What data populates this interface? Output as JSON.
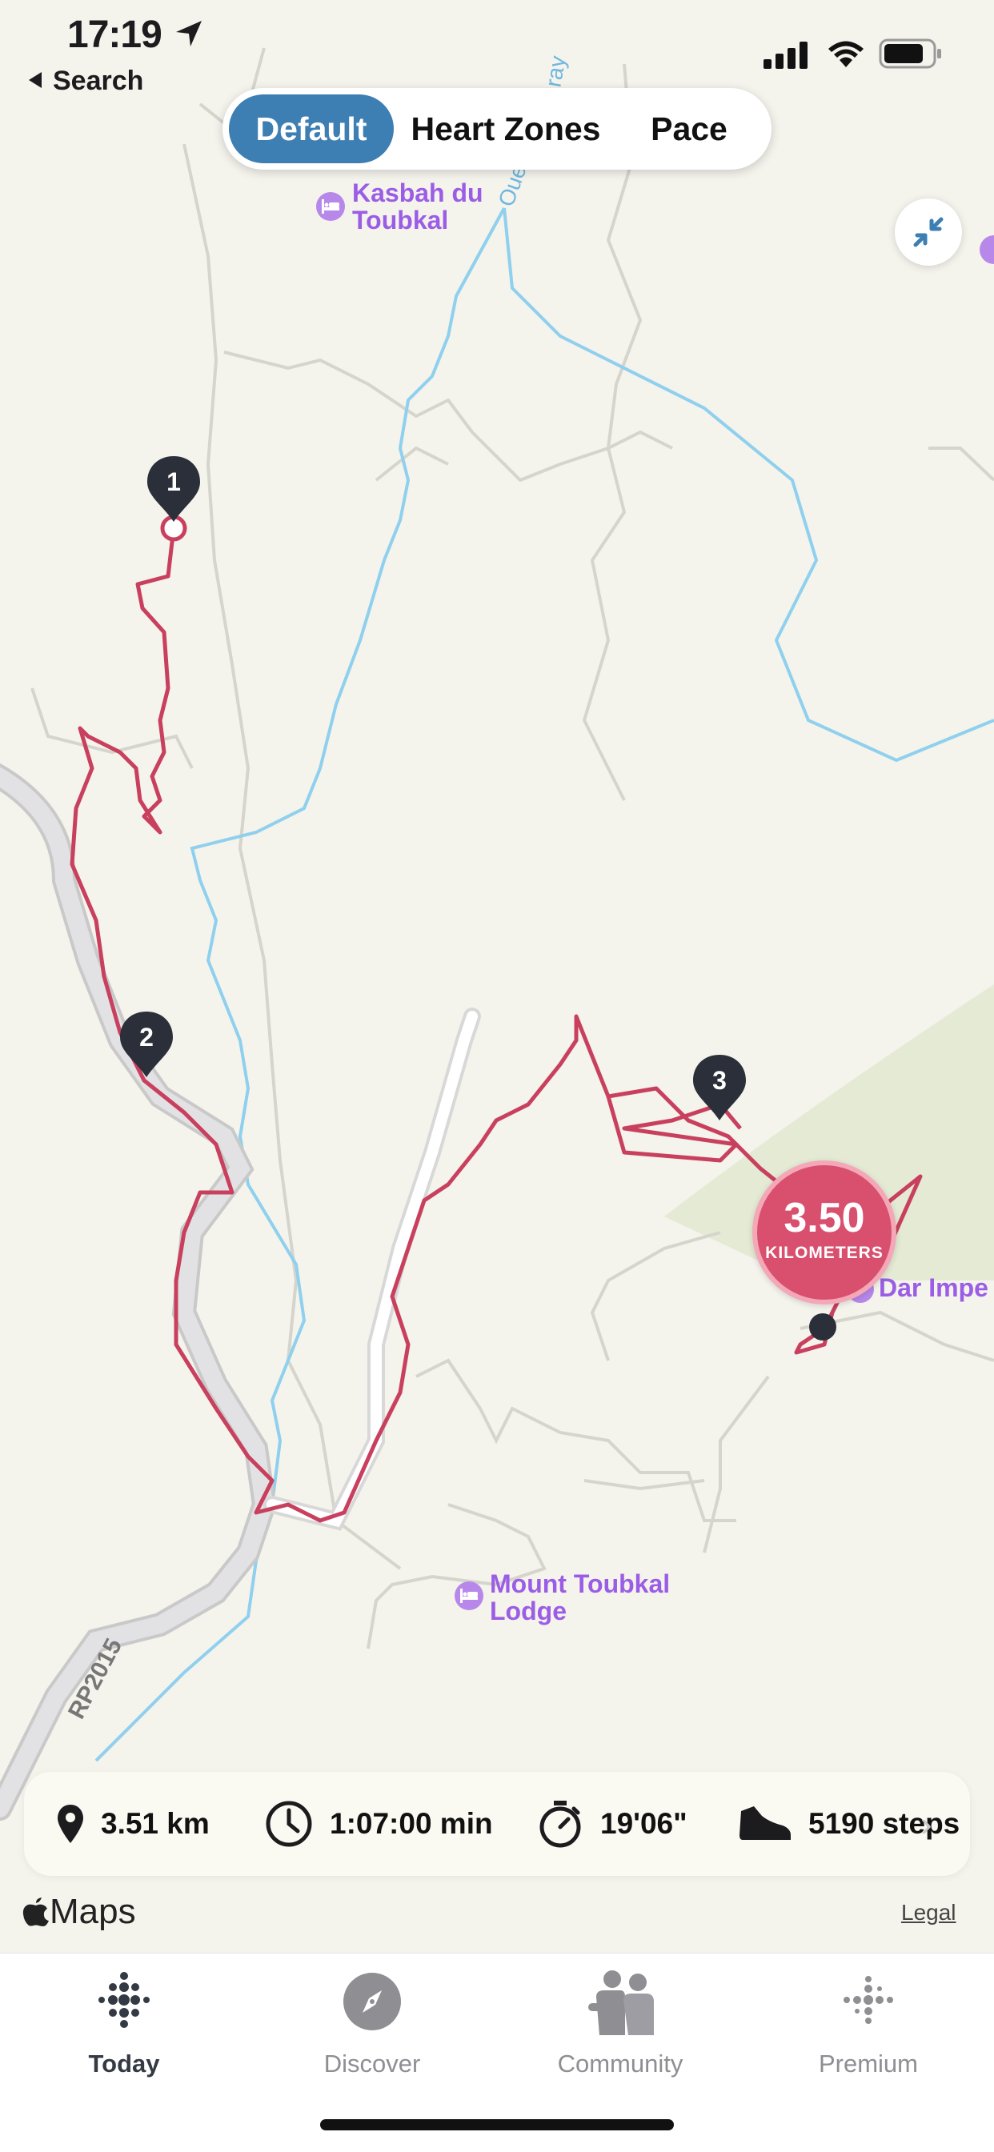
{
  "status_bar": {
    "time": "17:19",
    "back_label": "Search"
  },
  "segments": [
    {
      "label": "Default",
      "active": true
    },
    {
      "label": "Heart Zones",
      "active": false
    },
    {
      "label": "Pace",
      "active": false
    }
  ],
  "map": {
    "pois": [
      {
        "line1": "Kasbah du",
        "line2": "Toubkal"
      },
      {
        "line1": "Mount Toubkal",
        "line2": "Lodge"
      },
      {
        "line1": "Dar Impe",
        "line2": ""
      }
    ],
    "road_label": "RP2015",
    "water_label": "Oue",
    "water_label_2": "ray",
    "markers": [
      "1",
      "2",
      "3"
    ],
    "distance_badge": {
      "value": "3.50",
      "unit": "KILOMETERS"
    },
    "colors": {
      "route": "#c8405e",
      "water": "#8fd0ee",
      "road": "#d8d8d8",
      "land": "#f4f3ec"
    }
  },
  "stats": {
    "distance": "3.51 km",
    "duration": "1:07:00 min",
    "pace": "19'06\"",
    "steps": "5190 steps"
  },
  "attribution": {
    "maps": "Maps",
    "legal": "Legal"
  },
  "tabs": [
    {
      "label": "Today",
      "icon": "fitbit-dots-icon",
      "active": true
    },
    {
      "label": "Discover",
      "icon": "compass-icon",
      "active": false
    },
    {
      "label": "Community",
      "icon": "people-icon",
      "active": false
    },
    {
      "label": "Premium",
      "icon": "fitbit-plus-icon",
      "active": false
    }
  ]
}
